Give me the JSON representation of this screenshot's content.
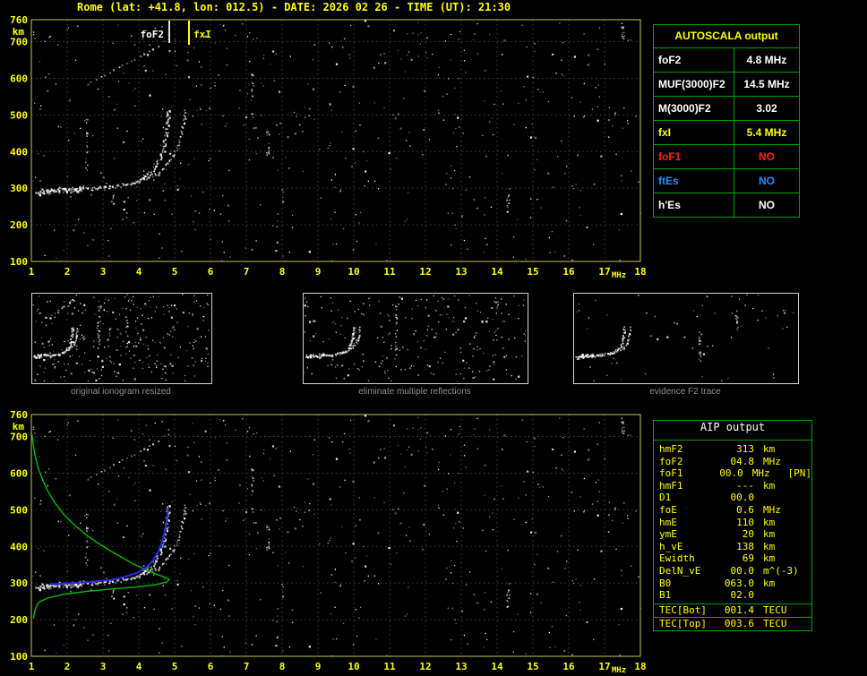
{
  "title": "Rome (lat: +41.8, lon: 012.5) - DATE: 2026 02 26 - TIME (UT): 21:30",
  "colors": {
    "background": "#000000",
    "title": "#ffff00",
    "plot_border": "#c8c850",
    "grid": "#2d4d2d",
    "axis_label": "#ffff00",
    "echo": "#ffffff",
    "profile_green": "#00bb00",
    "trace_blue": "#2a2aee",
    "table_border": "#00a000",
    "fof2_marker": "#e0e0e0",
    "fxi_marker": "#ffff00",
    "caption": "#8f8f8f"
  },
  "axes": {
    "x_min": 1,
    "x_max": 18,
    "y_min": 100,
    "y_max": 760,
    "x_ticks": [
      1,
      2,
      3,
      4,
      5,
      6,
      7,
      8,
      9,
      10,
      11,
      12,
      13,
      14,
      15,
      16,
      17,
      18
    ],
    "x_unit": "MHz",
    "y_ticks": [
      760,
      700,
      600,
      500,
      400,
      300,
      200,
      100
    ],
    "y_unit": "km"
  },
  "ionogram": {
    "foF2_marker": {
      "label": "foF2",
      "freq_mhz": 4.85
    },
    "fxI_marker": {
      "label": "fxI",
      "freq_mhz": 5.4
    },
    "o_trace": [
      [
        1.15,
        288
      ],
      [
        1.5,
        293
      ],
      [
        2.0,
        297
      ],
      [
        2.5,
        299
      ],
      [
        3.0,
        302
      ],
      [
        3.4,
        307
      ],
      [
        3.7,
        313
      ],
      [
        4.0,
        323
      ],
      [
        4.2,
        335
      ],
      [
        4.4,
        352
      ],
      [
        4.55,
        375
      ],
      [
        4.65,
        400
      ],
      [
        4.72,
        430
      ],
      [
        4.77,
        460
      ],
      [
        4.8,
        490
      ],
      [
        4.82,
        518
      ]
    ],
    "x_trace": [
      [
        3.9,
        318
      ],
      [
        4.2,
        328
      ],
      [
        4.5,
        341
      ],
      [
        4.7,
        358
      ],
      [
        4.9,
        382
      ],
      [
        5.05,
        410
      ],
      [
        5.15,
        440
      ],
      [
        5.22,
        470
      ],
      [
        5.27,
        498
      ],
      [
        5.3,
        518
      ]
    ],
    "second_hop": [
      [
        2.55,
        585
      ],
      [
        2.8,
        600
      ],
      [
        3.05,
        613
      ],
      [
        3.3,
        626
      ],
      [
        3.55,
        638
      ],
      [
        3.8,
        650
      ],
      [
        4.0,
        660
      ],
      [
        4.2,
        670
      ],
      [
        4.4,
        681
      ],
      [
        4.55,
        690
      ],
      [
        4.68,
        700
      ],
      [
        4.78,
        710
      ],
      [
        4.85,
        720
      ],
      [
        4.9,
        730
      ]
    ],
    "noise": {
      "seed": 1337,
      "count": 520,
      "streaks": 7
    }
  },
  "profile": {
    "green_curve": [
      [
        1.02,
        705
      ],
      [
        1.05,
        680
      ],
      [
        1.1,
        650
      ],
      [
        1.18,
        618
      ],
      [
        1.3,
        585
      ],
      [
        1.45,
        553
      ],
      [
        1.65,
        520
      ],
      [
        1.9,
        488
      ],
      [
        2.2,
        458
      ],
      [
        2.55,
        430
      ],
      [
        2.95,
        403
      ],
      [
        3.4,
        377
      ],
      [
        3.85,
        352
      ],
      [
        4.25,
        334
      ],
      [
        4.55,
        322
      ],
      [
        4.75,
        315
      ],
      [
        4.85,
        310
      ],
      [
        4.78,
        303
      ],
      [
        4.5,
        296
      ],
      [
        4.0,
        290
      ],
      [
        3.3,
        284
      ],
      [
        2.6,
        278
      ],
      [
        1.95,
        270
      ],
      [
        1.45,
        259
      ],
      [
        1.2,
        247
      ],
      [
        1.12,
        232
      ],
      [
        1.08,
        215
      ],
      [
        1.06,
        203
      ]
    ],
    "blue_trace": [
      [
        1.55,
        296
      ],
      [
        2.0,
        299
      ],
      [
        2.5,
        302
      ],
      [
        3.0,
        306
      ],
      [
        3.35,
        311
      ],
      [
        3.65,
        318
      ],
      [
        3.95,
        328
      ],
      [
        4.2,
        342
      ],
      [
        4.4,
        362
      ],
      [
        4.55,
        387
      ],
      [
        4.66,
        415
      ],
      [
        4.74,
        446
      ],
      [
        4.79,
        477
      ],
      [
        4.82,
        505
      ]
    ]
  },
  "thumbnails": [
    {
      "caption": "original ionogram resized",
      "noise_count": 300,
      "show_second_hop": true,
      "seed": 21
    },
    {
      "caption": "eliminate multiple reflections",
      "noise_count": 250,
      "show_second_hop": false,
      "seed": 22
    },
    {
      "caption": "evidence F2 trace",
      "noise_count": 60,
      "show_second_hop": false,
      "seed": 23
    }
  ],
  "autoscala": {
    "header": "AUTOSCALA output",
    "rows": [
      {
        "label": "foF2",
        "value": "4.8 MHz",
        "color": "white"
      },
      {
        "label": "MUF(3000)F2",
        "value": "14.5 MHz",
        "color": "white"
      },
      {
        "label": "M(3000)F2",
        "value": "3.02",
        "color": "white"
      },
      {
        "label": "fxI",
        "value": "5.4 MHz",
        "color": "yellow"
      },
      {
        "label": "foF1",
        "value": "NO",
        "color": "red"
      },
      {
        "label": "ftEs",
        "value": "NO",
        "color": "blue"
      },
      {
        "label": "h'Es",
        "value": "NO",
        "color": "white"
      }
    ]
  },
  "aip": {
    "header": "AIP output",
    "rows": [
      {
        "label": "hmF2",
        "value": "313",
        "unit": "km"
      },
      {
        "label": "foF2",
        "value": "04.8",
        "unit": "MHz"
      },
      {
        "label": "foF1",
        "value": "00.0",
        "unit": "MHz   [PN]"
      },
      {
        "label": "hmF1",
        "value": "---",
        "unit": "km"
      },
      {
        "label": "D1",
        "value": "00.0",
        "unit": ""
      },
      {
        "label": "foE",
        "value": "0.6",
        "unit": "MHz"
      },
      {
        "label": "hmE",
        "value": "110",
        "unit": "km"
      },
      {
        "label": "ymE",
        "value": "20",
        "unit": "km"
      },
      {
        "label": "h_vE",
        "value": "138",
        "unit": "km"
      },
      {
        "label": "Ewidth",
        "value": "69",
        "unit": "km"
      },
      {
        "label": "DelN_vE",
        "value": "00.0",
        "unit": "m^(-3)"
      },
      {
        "label": "B0",
        "value": "063.0",
        "unit": "km"
      },
      {
        "label": "B1",
        "value": "02.0",
        "unit": ""
      }
    ],
    "tec_rows": [
      {
        "label": "TEC[Bot]",
        "value": "001.4",
        "unit": "TECU"
      },
      {
        "label": "TEC[Top]",
        "value": "003.6",
        "unit": "TECU"
      }
    ]
  }
}
